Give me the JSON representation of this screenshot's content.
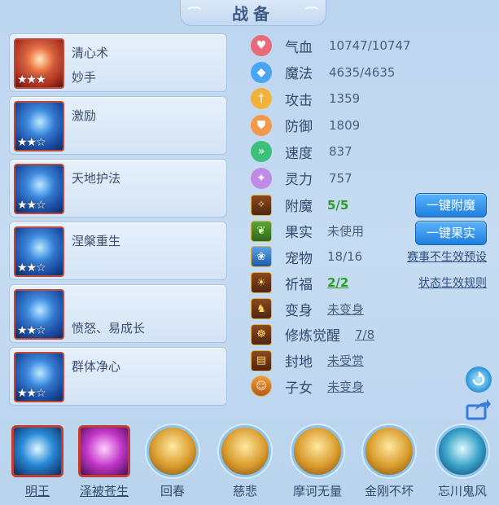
{
  "title": "战备",
  "skills": [
    {
      "name": "清心术",
      "sub": "妙手",
      "stars": "★★★",
      "icon": "clear-heart-icon",
      "tone": "red"
    },
    {
      "name": "激励",
      "sub": "",
      "stars": "★★☆",
      "icon": "inspire-icon",
      "tone": "blue"
    },
    {
      "name": "天地护法",
      "sub": "",
      "stars": "★★☆",
      "icon": "heaven-earth-guard-icon",
      "tone": "blue"
    },
    {
      "name": "涅槃重生",
      "sub": "",
      "stars": "★★☆",
      "icon": "nirvana-rebirth-icon",
      "tone": "blue"
    },
    {
      "name": "",
      "sub": "愤怒、易成长",
      "stars": "★★☆",
      "icon": "rage-icon",
      "tone": "blue"
    },
    {
      "name": "群体净心",
      "sub": "",
      "stars": "★★☆",
      "icon": "group-purify-icon",
      "tone": "blue"
    }
  ],
  "stats": [
    {
      "label": "气血",
      "value": "10747/10747",
      "icon": "heart-icon",
      "color": "#e96a7a"
    },
    {
      "label": "魔法",
      "value": "4635/4635",
      "icon": "mana-icon",
      "color": "#4aa5f2"
    },
    {
      "label": "攻击",
      "value": "1359",
      "icon": "attack-icon",
      "color": "#f2b23a"
    },
    {
      "label": "防御",
      "value": "1809",
      "icon": "defense-icon",
      "color": "#f29a4a"
    },
    {
      "label": "速度",
      "value": "837",
      "icon": "speed-icon",
      "color": "#3cc07a"
    },
    {
      "label": "灵力",
      "value": "757",
      "icon": "spirit-icon",
      "color": "#c08ae8"
    }
  ],
  "status": [
    {
      "label": "附魔",
      "value": "5/5",
      "style": "green",
      "icon": "enchant-icon",
      "iconTone": ""
    },
    {
      "label": "果实",
      "value": "未使用",
      "style": "",
      "icon": "fruit-icon",
      "iconTone": "green"
    },
    {
      "label": "宠物",
      "value": "18/16",
      "style": "",
      "icon": "pet-icon",
      "iconTone": "blue"
    },
    {
      "label": "祈福",
      "value": "2/2",
      "style": "green",
      "icon": "blessing-icon",
      "iconTone": ""
    },
    {
      "label": "变身",
      "value": "未变身",
      "style": "underline",
      "icon": "transform-icon",
      "iconTone": ""
    },
    {
      "label": "修炼觉醒",
      "value": "7/8",
      "style": "underline",
      "icon": "cultivation-icon",
      "iconTone": ""
    },
    {
      "label": "封地",
      "value": "未受赏",
      "style": "underline",
      "icon": "fief-icon",
      "iconTone": ""
    },
    {
      "label": "子女",
      "value": "未变身",
      "style": "underline",
      "icon": "children-icon",
      "iconTone": "orange"
    }
  ],
  "buttons": {
    "enchant": "一键附魔",
    "fruit": "一键果实"
  },
  "links": {
    "event_invalid_preset": "赛事不生效预设",
    "status_rules": "状态生效规则"
  },
  "bottom": [
    {
      "label": "明王",
      "tone": "blue",
      "square": true,
      "underline": true
    },
    {
      "label": "泽被苍生",
      "tone": "purple",
      "square": true,
      "underline": true
    },
    {
      "label": "回春",
      "tone": "gold",
      "square": false,
      "underline": false
    },
    {
      "label": "慈悲",
      "tone": "gold",
      "square": false,
      "underline": false
    },
    {
      "label": "摩诃无量",
      "tone": "gold",
      "square": false,
      "underline": false
    },
    {
      "label": "金刚不坏",
      "tone": "gold",
      "square": false,
      "underline": false
    },
    {
      "label": "忘川鬼风",
      "tone": "teal",
      "square": false,
      "underline": false
    }
  ]
}
